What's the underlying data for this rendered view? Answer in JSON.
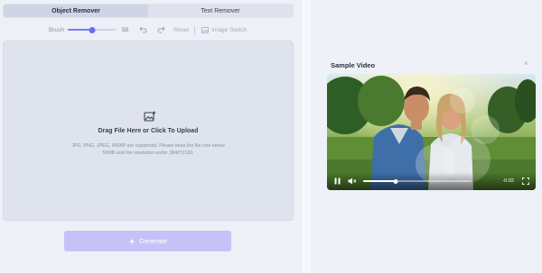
{
  "tabs": [
    {
      "label": "Object Remover",
      "active": true
    },
    {
      "label": "Text Remover",
      "active": false
    }
  ],
  "toolbar": {
    "brush_label": "Brush",
    "brush_value": "50",
    "brush_fraction": 0.5,
    "reset_label": "Reset",
    "image_switch_label": "Image Switch"
  },
  "upload": {
    "title": "Drag File Here or Click To Upload",
    "hint": "JPG, PNG, JPEG, WEBP are supported. Please keep the file size below 50MB and the resolution under 3840*2160."
  },
  "generate": {
    "label": "Generate"
  },
  "sample": {
    "title": "Sample Video",
    "close": "×",
    "time": "-0:02",
    "progress_fraction": 0.3
  },
  "colors": {
    "accent": "#6d6af0",
    "generate_bg": "#c6c2f7"
  }
}
